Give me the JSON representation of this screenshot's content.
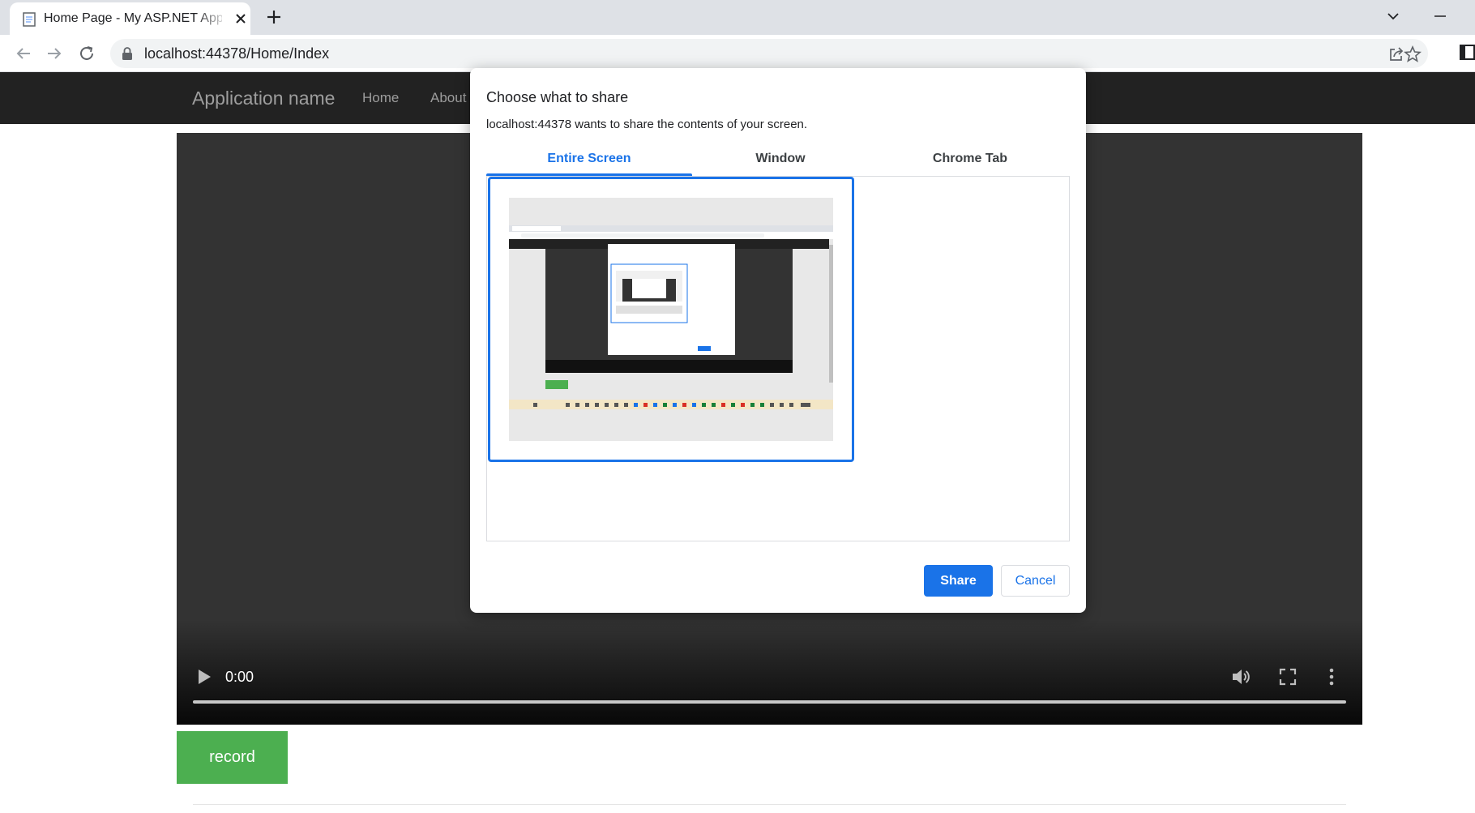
{
  "browser": {
    "tab_title": "Home Page - My ASP.NET Application",
    "url": "localhost:44378/Home/Index",
    "icons": [
      "document-icon",
      "close-icon",
      "plus-icon",
      "back-icon",
      "forward-icon",
      "reload-icon",
      "lock-icon",
      "share-icon",
      "star-icon",
      "side-panel-icon",
      "chevron-down-icon",
      "minimize-icon"
    ]
  },
  "page": {
    "brand": "Application name",
    "nav": [
      "Home",
      "About"
    ],
    "video": {
      "time": "0:00"
    },
    "record_label": "record"
  },
  "dialog": {
    "title": "Choose what to share",
    "description": "localhost:44378 wants to share the contents of your screen.",
    "tabs": [
      "Entire Screen",
      "Window",
      "Chrome Tab"
    ],
    "active_tab": "Entire Screen",
    "share_label": "Share",
    "cancel_label": "Cancel"
  },
  "colors": {
    "accent": "#1a73e8",
    "record": "#4caf50",
    "navbar": "#222222",
    "video": "#333333"
  }
}
